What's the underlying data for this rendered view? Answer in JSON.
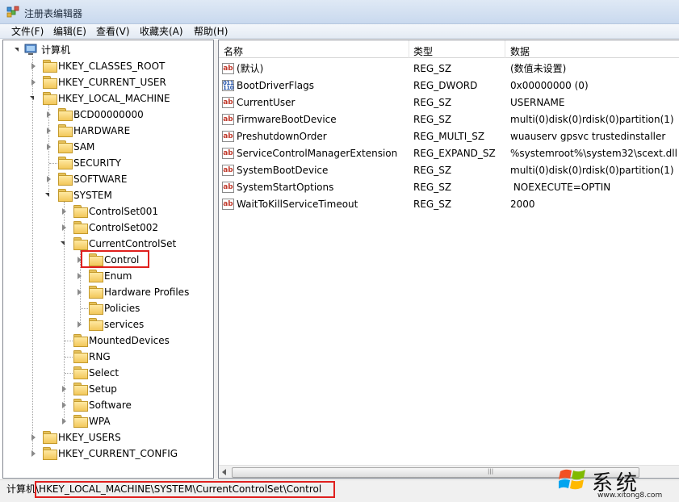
{
  "window": {
    "title": "注册表编辑器"
  },
  "menu": [
    "文件(F)",
    "编辑(E)",
    "查看(V)",
    "收藏夹(A)",
    "帮助(H)"
  ],
  "tree": {
    "root": "计算机",
    "items": [
      "HKEY_CLASSES_ROOT",
      "HKEY_CURRENT_USER",
      "HKEY_LOCAL_MACHINE",
      "BCD00000000",
      "HARDWARE",
      "SAM",
      "SECURITY",
      "SOFTWARE",
      "SYSTEM",
      "ControlSet001",
      "ControlSet002",
      "CurrentControlSet",
      "Control",
      "Enum",
      "Hardware Profiles",
      "Policies",
      "services",
      "MountedDevices",
      "RNG",
      "Select",
      "Setup",
      "Software",
      "WPA",
      "HKEY_USERS",
      "HKEY_CURRENT_CONFIG"
    ],
    "selected": "Control"
  },
  "list": {
    "columns": [
      "名称",
      "类型",
      "数据"
    ],
    "rows": [
      {
        "name": "(默认)",
        "type": "REG_SZ",
        "data": "(数值未设置)",
        "icon": "string-value-icon"
      },
      {
        "name": "BootDriverFlags",
        "type": "REG_DWORD",
        "data": "0x00000000 (0)",
        "icon": "binary-value-icon"
      },
      {
        "name": "CurrentUser",
        "type": "REG_SZ",
        "data": "USERNAME",
        "icon": "string-value-icon"
      },
      {
        "name": "FirmwareBootDevice",
        "type": "REG_SZ",
        "data": "multi(0)disk(0)rdisk(0)partition(1)",
        "icon": "string-value-icon"
      },
      {
        "name": "PreshutdownOrder",
        "type": "REG_MULTI_SZ",
        "data": "wuauserv gpsvc trustedinstaller",
        "icon": "string-value-icon"
      },
      {
        "name": "ServiceControlManagerExtension",
        "type": "REG_EXPAND_SZ",
        "data": "%systemroot%\\system32\\scext.dll",
        "icon": "string-value-icon"
      },
      {
        "name": "SystemBootDevice",
        "type": "REG_SZ",
        "data": "multi(0)disk(0)rdisk(0)partition(1)",
        "icon": "string-value-icon"
      },
      {
        "name": "SystemStartOptions",
        "type": "REG_SZ",
        "data": " NOEXECUTE=OPTIN",
        "icon": "string-value-icon"
      },
      {
        "name": "WaitToKillServiceTimeout",
        "type": "REG_SZ",
        "data": "2000",
        "icon": "string-value-icon"
      }
    ]
  },
  "status": {
    "path": "计算机\\HKEY_LOCAL_MACHINE\\SYSTEM\\CurrentControlSet\\Control"
  },
  "watermark": {
    "text": "系统",
    "url": "www.xitong8.com"
  },
  "colors": {
    "highlight_red": "#e0201e",
    "title_gradient": "#c9d9ee"
  }
}
